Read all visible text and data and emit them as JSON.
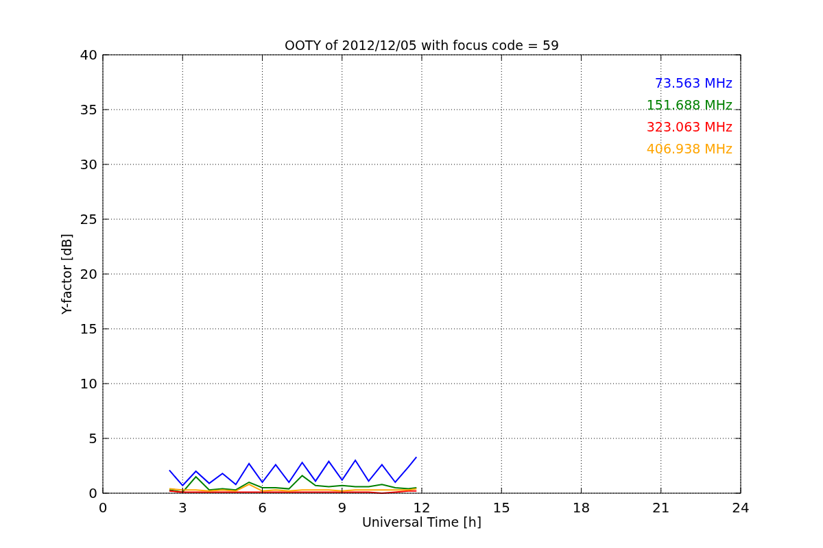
{
  "chart": {
    "chart_data": {
      "type": "line",
      "title": "OOTY of 2012/12/05 with focus code = 59",
      "xlabel": "Universal Time [h]",
      "ylabel": "Y-factor [dB]",
      "x": [
        2.5,
        3,
        3.5,
        4,
        4.5,
        5,
        5.5,
        6,
        6.5,
        7,
        7.5,
        8,
        8.5,
        9,
        9.5,
        10,
        10.5,
        11,
        11.5,
        11.8
      ],
      "series": [
        {
          "name": "73.563 MHz",
          "color": "#0000ff",
          "values": [
            2.1,
            0.7,
            2.0,
            0.9,
            1.8,
            0.8,
            2.7,
            1.0,
            2.6,
            1.0,
            2.8,
            1.1,
            2.9,
            1.2,
            3.0,
            1.1,
            2.6,
            1.0,
            2.4,
            3.3
          ]
        },
        {
          "name": "151.688 MHz",
          "color": "#008000",
          "values": [
            0.3,
            0.1,
            1.5,
            0.3,
            0.4,
            0.3,
            1.0,
            0.5,
            0.5,
            0.4,
            1.6,
            0.7,
            0.6,
            0.7,
            0.6,
            0.6,
            0.8,
            0.5,
            0.4,
            0.5
          ]
        },
        {
          "name": "323.063 MHz",
          "color": "#ff0000",
          "values": [
            0.2,
            0.1,
            0.1,
            0.1,
            0.1,
            0.1,
            0.1,
            0.1,
            0.1,
            0.1,
            0.1,
            0.1,
            0.1,
            0.1,
            0.1,
            0.1,
            0.0,
            0.1,
            0.2,
            0.2
          ]
        },
        {
          "name": "406.938 MHz",
          "color": "#ffa500",
          "values": [
            0.4,
            0.3,
            0.3,
            0.2,
            0.3,
            0.2,
            0.8,
            0.2,
            0.3,
            0.2,
            0.3,
            0.3,
            0.3,
            0.2,
            0.3,
            0.3,
            0.3,
            0.3,
            0.3,
            0.4
          ]
        }
      ],
      "xlim": [
        0,
        24
      ],
      "ylim": [
        0,
        40
      ],
      "xticks": [
        0,
        3,
        6,
        9,
        12,
        15,
        18,
        21,
        24
      ],
      "yticks": [
        0,
        5,
        10,
        15,
        20,
        25,
        30,
        35,
        40
      ],
      "grid": true
    }
  }
}
